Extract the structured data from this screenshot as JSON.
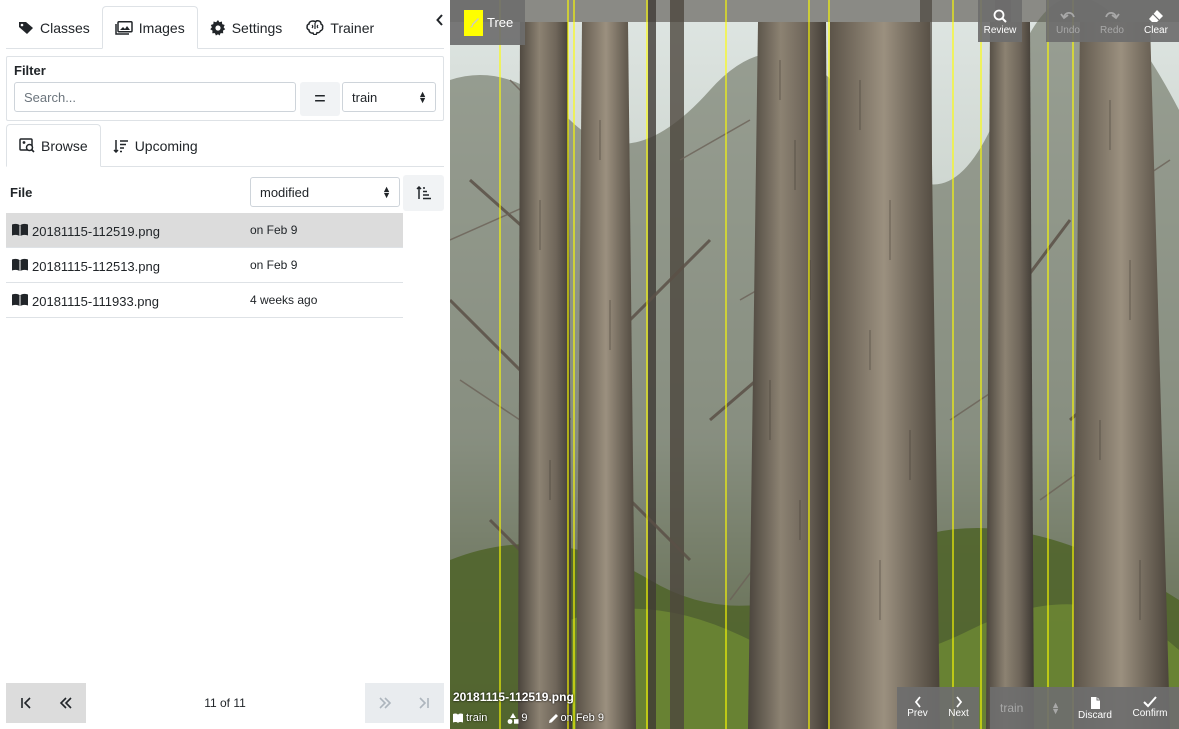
{
  "tabs": [
    {
      "label": "Classes",
      "icon": "tag-icon"
    },
    {
      "label": "Images",
      "icon": "images-icon",
      "active": true
    },
    {
      "label": "Settings",
      "icon": "gear-icon"
    },
    {
      "label": "Trainer",
      "icon": "brain-icon"
    }
  ],
  "filter": {
    "title": "Filter",
    "search_placeholder": "Search...",
    "search_value": "",
    "match_symbol": "=",
    "set_value": "train"
  },
  "subtabs": [
    {
      "label": "Browse",
      "icon": "image-search-icon",
      "active": true
    },
    {
      "label": "Upcoming",
      "icon": "sort-list-icon"
    }
  ],
  "file_list": {
    "header": "File",
    "sort_value": "modified",
    "rows": [
      {
        "name": "20181115-112519.png",
        "date": "on Feb 9",
        "selected": true
      },
      {
        "name": "20181115-112513.png",
        "date": "on Feb 9",
        "selected": false
      },
      {
        "name": "20181115-111933.png",
        "date": "4 weeks ago",
        "selected": false
      }
    ]
  },
  "pager": {
    "text": "11 of 11"
  },
  "viewer": {
    "class_name": "Tree",
    "class_color": "#ffff00",
    "toolbar": [
      {
        "label": "Review",
        "icon": "search-icon",
        "enabled": true
      },
      {
        "label": "Undo",
        "icon": "undo-icon",
        "enabled": false
      },
      {
        "label": "Redo",
        "icon": "redo-icon",
        "enabled": false
      },
      {
        "label": "Clear",
        "icon": "eraser-icon",
        "enabled": true
      }
    ],
    "image_name": "20181115-112519.png",
    "meta_set": "train",
    "meta_count": "9",
    "meta_modified": "on Feb 9",
    "nav": {
      "prev": "Prev",
      "next": "Next"
    },
    "bottom": {
      "set_value": "train",
      "discard": "Discard",
      "confirm": "Confirm"
    }
  }
}
